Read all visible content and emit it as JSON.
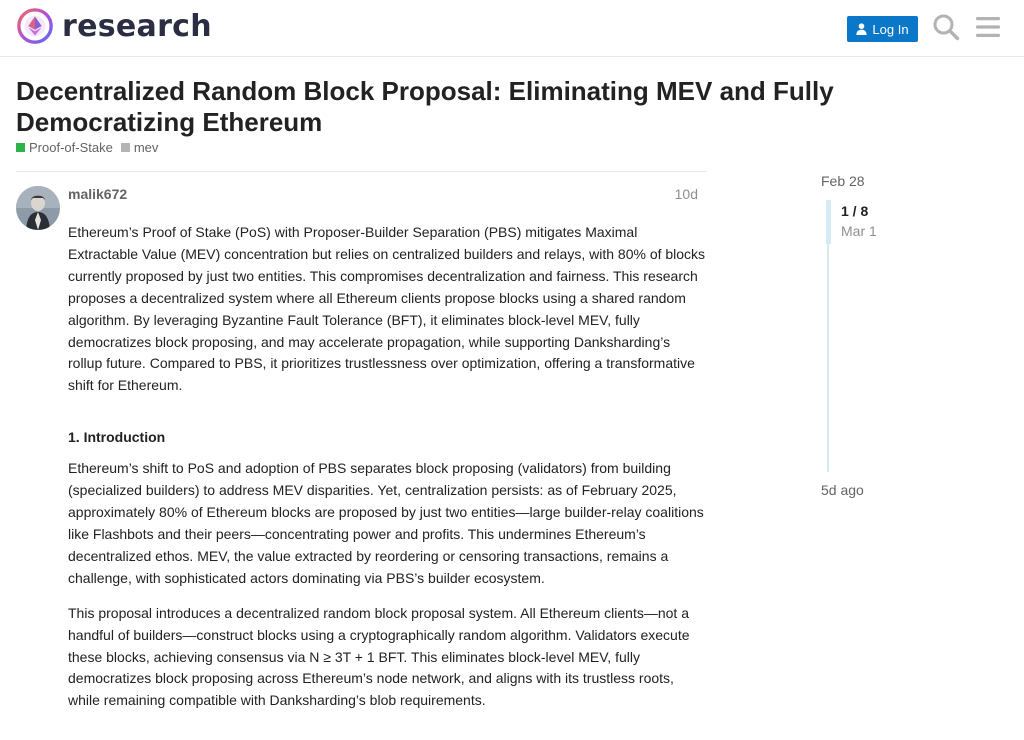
{
  "header": {
    "site_name": "research",
    "login_label": "Log In"
  },
  "topic": {
    "title": "Decentralized Random Block Proposal: Eliminating MEV and Fully Democratizing Ethereum",
    "tags": [
      {
        "label": "Proof-of-Stake",
        "color": "#2db34a"
      },
      {
        "label": "mev",
        "color": "#b3b5b4"
      }
    ]
  },
  "post": {
    "username": "malik672",
    "age": "10d",
    "paragraphs": [
      "Ethereum’s Proof of Stake (PoS) with Proposer-Builder Separation (PBS) mitigates Maximal Extractable Value (MEV) concentration but relies on centralized builders and relays, with 80% of blocks currently proposed by just two entities. This compromises decentralization and fairness. This research proposes a decentralized system where all Ethereum clients propose blocks using a shared random algorithm. By leveraging Byzantine Fault Tolerance (BFT), it eliminates block-level MEV, fully democratizes block proposing, and may accelerate propagation, while supporting Danksharding’s rollup future. Compared to PBS, it prioritizes trustlessness over optimization, offering a transformative shift for Ethereum.",
      "Ethereum’s shift to PoS and adoption of PBS separates block proposing (validators) from building (specialized builders) to address MEV disparities. Yet, centralization persists: as of February 2025, approximately 80% of Ethereum blocks are proposed by just two entities—large builder-relay coalitions like Flashbots and their peers—concentrating power and profits. This undermines Ethereum’s decentralized ethos. MEV, the value extracted by reordering or censoring transactions, remains a challenge, with sophisticated actors dominating via PBS’s builder ecosystem.",
      "This proposal introduces a decentralized random block proposal system. All Ethereum clients—not a handful of builders—construct blocks using a cryptographically random algorithm. Validators execute these blocks, achieving consensus via N ≥ 3T + 1 BFT. This eliminates block-level MEV, fully democratizes block proposing across Ethereum’s node network, and aligns with its trustless roots, while remaining compatible with Danksharding’s blob requirements."
    ],
    "section_heading": "1. Introduction"
  },
  "timeline": {
    "start_date": "Feb 28",
    "position": "1 / 8",
    "position_date": "Mar 1",
    "end_date": "5d ago",
    "progress": 0.125
  }
}
